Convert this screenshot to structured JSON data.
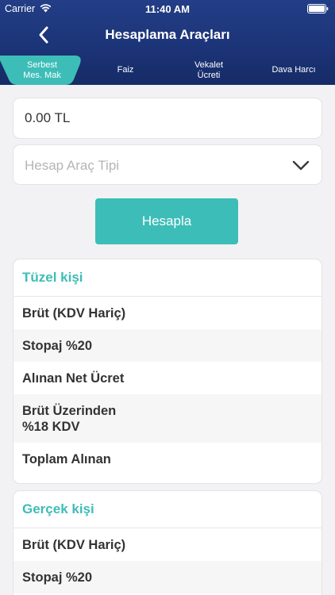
{
  "status_bar": {
    "carrier": "Carrier",
    "time": "11:40 AM"
  },
  "nav": {
    "title": "Hesaplama Araçları",
    "back_icon": "chevron-left-icon"
  },
  "tabs": [
    {
      "line1": "Serbest",
      "line2": "Mes. Mak",
      "active": true
    },
    {
      "line1": "Faiz",
      "line2": ""
    },
    {
      "line1": "Vekalet",
      "line2": "Ücreti"
    },
    {
      "line1": "Dava Harcı",
      "line2": ""
    }
  ],
  "form": {
    "amount_value": "0.00 TL",
    "type_placeholder": "Hesap Araç Tipi",
    "calculate_label": "Hesapla"
  },
  "sections": {
    "tuzel": {
      "title": "Tüzel kişi",
      "rows": [
        "Brüt (KDV Hariç)",
        "Stopaj %20",
        "Alınan Net Ücret",
        "Brüt Üzerinden",
        "%18 KDV",
        "Toplam Alınan"
      ]
    },
    "gercek": {
      "title": "Gerçek kişi",
      "rows": [
        "Brüt (KDV Hariç)",
        "Stopaj %20"
      ]
    }
  },
  "colors": {
    "header": "#1c3478",
    "active_tab": "#3dbdb7",
    "accent": "#3dbdb7"
  }
}
